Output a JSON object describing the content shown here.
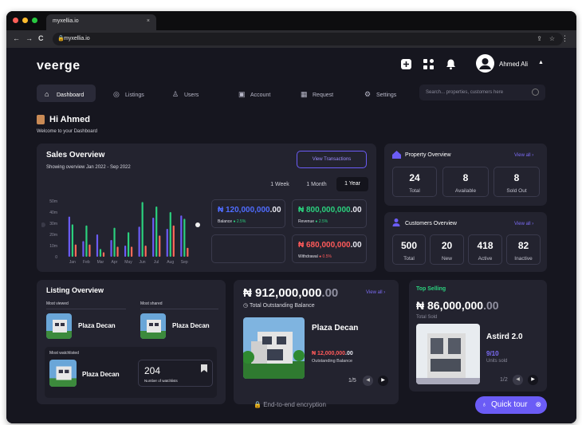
{
  "browser": {
    "tab_title": "myxellia.io",
    "tab_close": "×",
    "url": "myxellia.io",
    "back": "←",
    "forward": "→",
    "reload": "C",
    "menu": "⋮"
  },
  "header": {
    "brand": "veerge",
    "user_name": "Ahmed Ali",
    "caret": "▲"
  },
  "nav": {
    "items": [
      {
        "label": "Dashboard",
        "icon": "home-icon"
      },
      {
        "label": "Listings",
        "icon": "pin-icon"
      },
      {
        "label": "Users",
        "icon": "user-icon"
      },
      {
        "label": "Account",
        "icon": "wallet-icon"
      },
      {
        "label": "Request",
        "icon": "calendar-icon"
      },
      {
        "label": "Settings",
        "icon": "gear-icon"
      }
    ],
    "search_placeholder": "Search... properties, customers here"
  },
  "greeting": {
    "title": "Hi Ahmed",
    "subtitle": "Welcome to your Dashboard"
  },
  "sales": {
    "title": "Sales Overview",
    "subtitle": "Showing overview Jan 2022 - Sep 2022",
    "view_transactions": "View Transactions",
    "periods": [
      "1 Week",
      "1 Month",
      "1 Year"
    ],
    "active_period": "1 Year",
    "balance": {
      "amount": "₦ 120,000,000",
      "dec": ".00",
      "label": "Balance",
      "change": "2.5%",
      "color": "#4f6cff"
    },
    "revenue": {
      "amount": "₦ 800,000,000",
      "dec": ".00",
      "label": "Revenue",
      "change": "2.5%",
      "color": "#2bd17e"
    },
    "withdrawal": {
      "amount": "₦ 680,000,000",
      "dec": ".00",
      "label": "Withdrawal",
      "change": "0.5%",
      "color": "#ff5a5a"
    }
  },
  "chart_data": {
    "type": "bar",
    "categories": [
      "Jan",
      "Feb",
      "Mar",
      "Apr",
      "May",
      "Jun",
      "Jul",
      "Aug",
      "Sep"
    ],
    "y_tick_labels": [
      "50m",
      "40m",
      "30m",
      "20m",
      "10m",
      "0"
    ],
    "ylim": [
      0,
      50
    ],
    "series": [
      {
        "color": "#6b5cf6",
        "values": [
          36,
          14,
          20,
          15,
          10,
          27,
          35,
          25,
          37
        ]
      },
      {
        "color": "#2bd17e",
        "values": [
          29,
          28,
          7,
          26,
          22,
          49,
          45,
          40,
          34
        ]
      },
      {
        "color": "#ff6b5a",
        "values": [
          11,
          11,
          4,
          9,
          9,
          10,
          19,
          28,
          8
        ]
      }
    ]
  },
  "property_overview": {
    "title": "Property Overview",
    "view_all": "View all",
    "stats": [
      {
        "value": "24",
        "label": "Total"
      },
      {
        "value": "8",
        "label": "Available"
      },
      {
        "value": "8",
        "label": "Sold Out"
      }
    ]
  },
  "customers_overview": {
    "title": "Customers Overview",
    "view_all": "View all",
    "stats": [
      {
        "value": "500",
        "label": "Total"
      },
      {
        "value": "20",
        "label": "New"
      },
      {
        "value": "418",
        "label": "Active"
      },
      {
        "value": "82",
        "label": "Inactive"
      }
    ]
  },
  "listing_overview": {
    "title": "Listing Overview",
    "most_viewed_label": "Most viewed",
    "most_viewed_name": "Plaza Decan",
    "most_shared_label": "Most shared",
    "most_shared_name": "Plaza Decan",
    "most_watchlisted_label": "Most watchlisted",
    "most_watchlisted_name": "Plaza Decan",
    "watchlists_count": "204",
    "watchlists_label": "Number of watchlists"
  },
  "outstanding": {
    "amount": "₦ 912,000,000",
    "dec": ".00",
    "label": "Total Outstanding Balance",
    "view_all": "View all",
    "property_name": "Plaza Decan",
    "property_amount": "₦ 12,000,000",
    "property_dec": ".00",
    "property_label": "Outstanding Balance",
    "pager": "1/5"
  },
  "top_selling": {
    "title": "Top Selling",
    "amount": "₦ 86,000,000",
    "dec": ".00",
    "label": "Total Sold",
    "property_name": "Astird 2.0",
    "units": "9/10",
    "units_label": "Units sold",
    "pager": "1/2"
  },
  "footer": {
    "encryption": "End-to-end encryption",
    "quick_tour": "Quick tour"
  }
}
